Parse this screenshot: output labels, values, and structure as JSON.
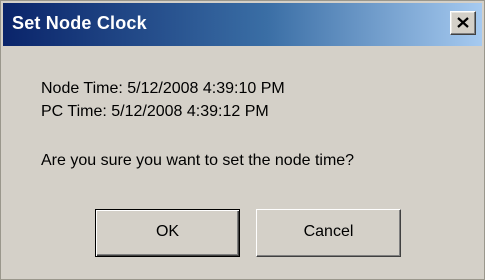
{
  "window": {
    "title": "Set Node Clock",
    "close_icon": "close-icon"
  },
  "message": {
    "node_time": "Node Time: 5/12/2008 4:39:10 PM",
    "pc_time": "PC Time: 5/12/2008 4:39:12 PM",
    "question": "Are you sure you want to set the node time?"
  },
  "buttons": {
    "ok_label": "OK",
    "cancel_label": "Cancel"
  },
  "colors": {
    "title_gradient_start": "#0a246a",
    "title_gradient_end": "#a6caf0",
    "dialog_face": "#d4d0c8"
  }
}
